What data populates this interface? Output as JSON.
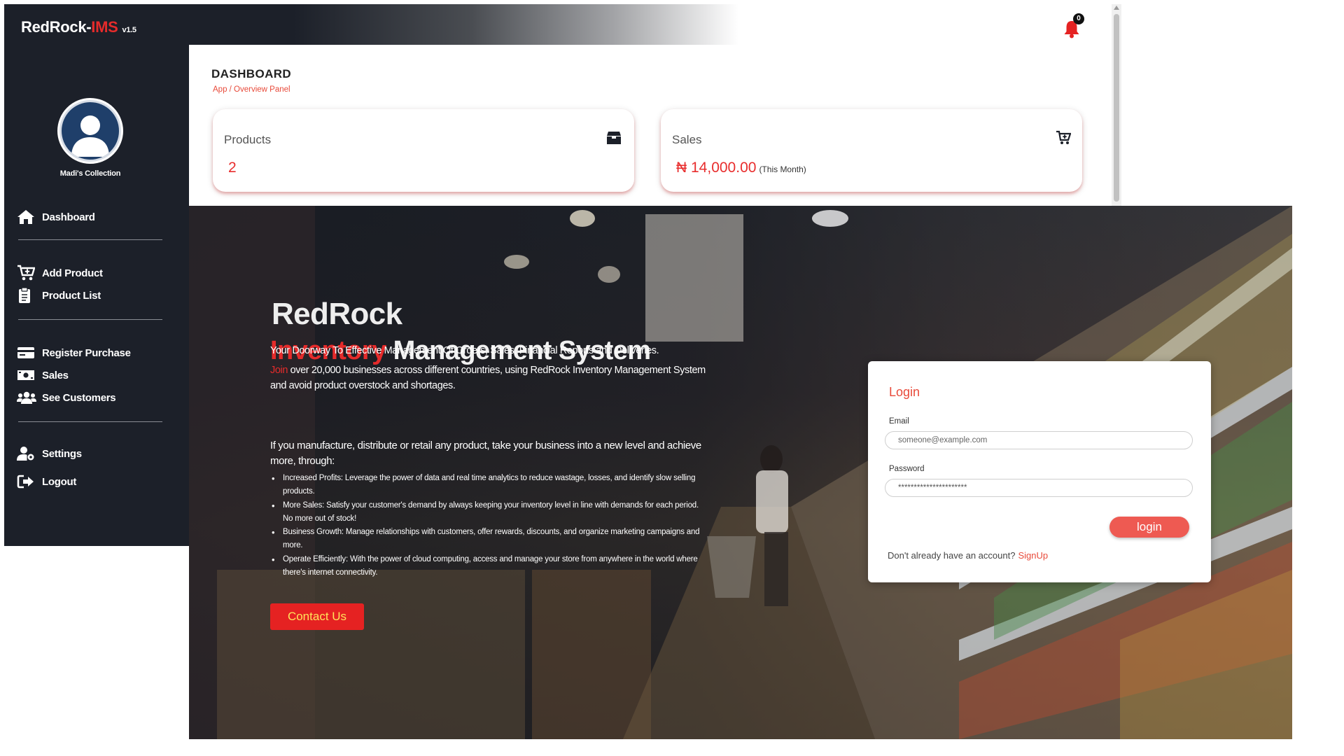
{
  "app": {
    "brand_name": "RedRock-",
    "brand_suffix": "IMS",
    "version": "v1.5",
    "notification_count": "0"
  },
  "sidebar": {
    "profile_name": "Madi's Collection",
    "items": [
      {
        "label": "Dashboard",
        "icon": "home-icon"
      },
      {
        "label": "Add Product",
        "icon": "cart-plus-icon"
      },
      {
        "label": "Product List",
        "icon": "clipboard-list-icon"
      },
      {
        "label": "Register Purchase",
        "icon": "credit-card-icon"
      },
      {
        "label": "Sales",
        "icon": "money-bill-icon"
      },
      {
        "label": "See Customers",
        "icon": "users-icon"
      },
      {
        "label": "Settings",
        "icon": "user-cog-icon"
      },
      {
        "label": "Logout",
        "icon": "sign-out-icon"
      }
    ]
  },
  "dashboard": {
    "title": "DASHBOARD",
    "breadcrumb": "App / Overview Panel",
    "cards": [
      {
        "label": "Products",
        "value": "2",
        "note": "",
        "icon": "box-icon"
      },
      {
        "label": "Sales",
        "value": "₦ 14,000.00",
        "note": "(This Month)",
        "icon": "cart-icon"
      }
    ]
  },
  "landing": {
    "title_line1": "RedRock",
    "title_red": "Inventory",
    "title_rest": " Management System",
    "tagline": "Your Doorway To Effective Management Of Orders, Sales, Financial Reports and Deliveries.",
    "join_word": "Join",
    "join_text": " over 20,000 businesses across different countries, using RedRock Inventory Management System and avoid product overstock and shortages.",
    "intro": "If you manufacture, distribute or retail any product, take your business into a new level and achieve more, through:",
    "bullets": [
      "Increased Profits: Leverage the power of data and real time analytics to reduce wastage, losses, and identify slow selling products.",
      "More Sales: Satisfy your customer's demand by always keeping your inventory level in line with demands for each period. No more out of stock!",
      "Business Growth: Manage relationships with customers, offer rewards, discounts, and organize marketing campaigns and more.",
      "Operate Efficiently: With the power of cloud computing, access and manage your store from anywhere in the world where there's internet connectivity."
    ],
    "contact_label": "Contact Us"
  },
  "login": {
    "title": "Login",
    "email_label": "Email",
    "email_placeholder": "someone@example.com",
    "password_label": "Password",
    "password_value": "**********************",
    "button_label": "login",
    "signup_prompt": "Don't already have an account?",
    "signup_link": "SignUp"
  },
  "colors": {
    "brand_red": "#e52b2b",
    "sidebar_bg": "#1c2029",
    "accent_coral": "#ee5a52"
  }
}
